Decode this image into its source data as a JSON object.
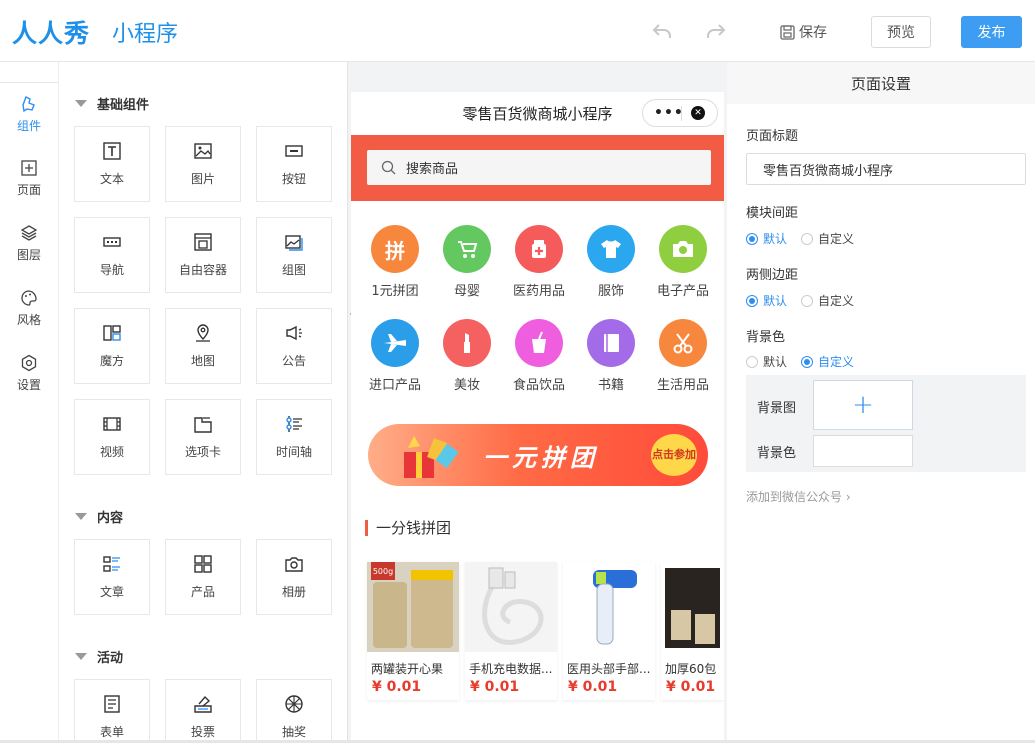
{
  "header": {
    "logo": "人人秀",
    "logo_sub": "小程序",
    "save_label": "保存",
    "preview_label": "预览",
    "publish_label": "发布"
  },
  "leftnav": {
    "items": [
      {
        "label": "组件",
        "icon": "components-icon",
        "active": true
      },
      {
        "label": "页面",
        "icon": "page-plus-icon"
      },
      {
        "label": "图层",
        "icon": "layers-icon"
      },
      {
        "label": "风格",
        "icon": "palette-icon"
      },
      {
        "label": "设置",
        "icon": "settings-hex-icon"
      }
    ]
  },
  "palette": {
    "sections": [
      {
        "title": "基础组件",
        "items": [
          "文本",
          "图片",
          "按钮",
          "导航",
          "自由容器",
          "组图",
          "魔方",
          "地图",
          "公告",
          "视频",
          "选项卡",
          "时间轴"
        ]
      },
      {
        "title": "内容",
        "items": [
          "文章",
          "产品",
          "相册"
        ]
      },
      {
        "title": "活动",
        "items": [
          "表单",
          "投票",
          "抽奖"
        ]
      }
    ]
  },
  "phone": {
    "title": "零售百货微商城小程序",
    "search_placeholder": "搜索商品",
    "categories": [
      {
        "label": "1元拼团",
        "glyph": "拼",
        "color": "#f7873c"
      },
      {
        "label": "母婴",
        "glyph": "stroller",
        "color": "#63c860"
      },
      {
        "label": "医药用品",
        "glyph": "medicine",
        "color": "#f55b5b"
      },
      {
        "label": "服饰",
        "glyph": "shirt",
        "color": "#2aa7ef"
      },
      {
        "label": "电子产品",
        "glyph": "camera",
        "color": "#8fcf3f"
      },
      {
        "label": "进口产品",
        "glyph": "plane",
        "color": "#2a9ee8"
      },
      {
        "label": "美妆",
        "glyph": "lipstick",
        "color": "#f56060"
      },
      {
        "label": "食品饮品",
        "glyph": "drink",
        "color": "#f05ee0"
      },
      {
        "label": "书籍",
        "glyph": "book",
        "color": "#a46be8"
      },
      {
        "label": "生活用品",
        "glyph": "scissors",
        "color": "#f7873c"
      }
    ],
    "banner_text": "一元拼团",
    "banner_button": "点击参加",
    "group_title": "一分钱拼团",
    "products": [
      {
        "name": "两罐装开心果",
        "price": "¥ 0.01"
      },
      {
        "name": "手机充电数据...",
        "price": "¥ 0.01"
      },
      {
        "name": "医用头部手部...",
        "price": "¥ 0.01"
      },
      {
        "name": "加厚60包",
        "price": "¥ 0.01"
      }
    ]
  },
  "settings": {
    "header": "页面设置",
    "page_title_label": "页面标题",
    "page_title_value": "零售百货微商城小程序",
    "module_spacing_label": "模块间距",
    "side_margin_label": "两侧边距",
    "bg_color_label": "背景色",
    "opt_default": "默认",
    "opt_custom": "自定义",
    "bg_image_label": "背景图",
    "bg_color_field_label": "背景色",
    "wechat_link": "添加到微信公众号"
  }
}
